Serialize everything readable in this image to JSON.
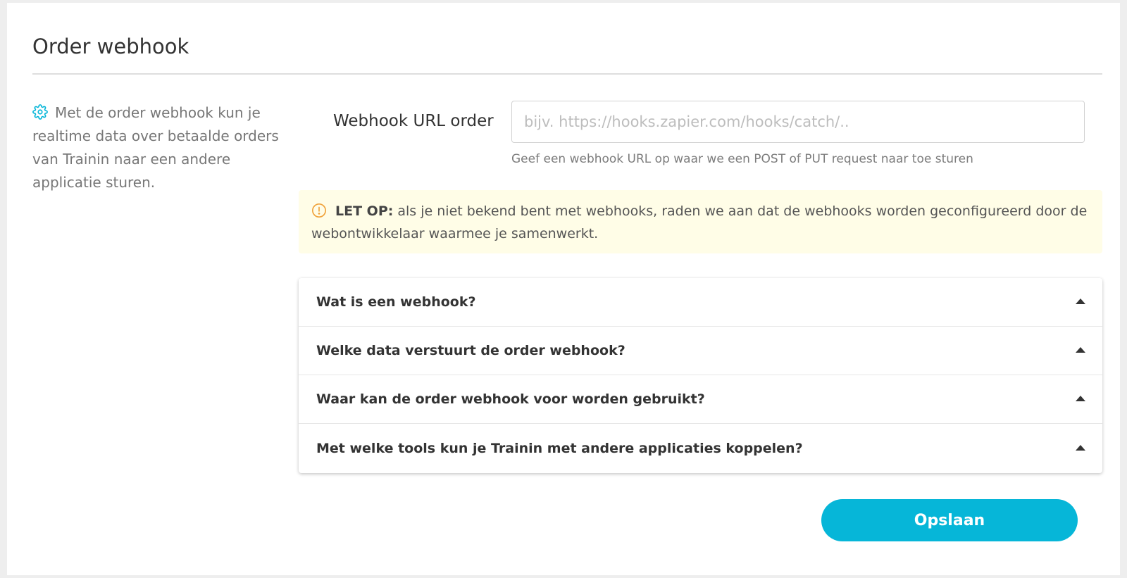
{
  "page": {
    "title": "Order webhook"
  },
  "sidebar": {
    "icon": "gear-icon",
    "description": "Met de order webhook kun je realtime data over betaalde orders van Trainin naar een andere applicatie sturen."
  },
  "form": {
    "url_label": "Webhook URL order",
    "url_value": "",
    "url_placeholder": "bijv. https://hooks.zapier.com/hooks/catch/..",
    "url_help": "Geef een webhook URL op waar we een POST of PUT request naar toe sturen"
  },
  "warning": {
    "icon": "alert-circle-icon",
    "label": "LET OP:",
    "text": " als je niet bekend bent met webhooks, raden we aan dat de webhooks worden geconfigureerd door de webontwikkelaar waarmee je samenwerkt."
  },
  "faq": {
    "items": [
      {
        "title": "Wat is een webhook?"
      },
      {
        "title": "Welke data verstuurt de order webhook?"
      },
      {
        "title": "Waar kan de order webhook voor worden gebruikt?"
      },
      {
        "title": "Met welke tools kun je Trainin met andere applicaties koppelen?"
      }
    ]
  },
  "actions": {
    "save_label": "Opslaan"
  },
  "colors": {
    "accent": "#06b6d8",
    "warning_background": "#fffde7",
    "warning_icon": "#f0a23a"
  }
}
